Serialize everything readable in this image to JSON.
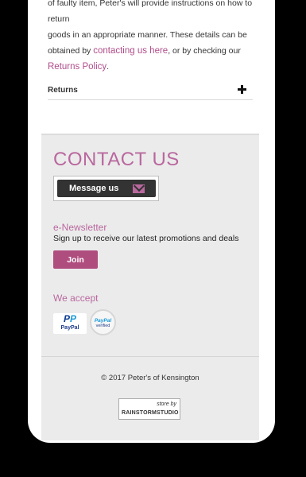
{
  "policy": {
    "line1": "of faulty item, Peter's will provide instructions on how to return",
    "line2": "goods in an appropriate manner. These details can be",
    "line3_pre": "obtained by",
    "contact_link": "contacting us here",
    "line3_post": ", or by checking our",
    "returns_policy_link": "Returns Policy",
    "period": "."
  },
  "accordion": {
    "returns_label": "Returns",
    "toggle_icon": "plus-icon"
  },
  "contact": {
    "title": "CONTACT US",
    "message_button": "Message us",
    "message_icon": "envelope-icon"
  },
  "newsletter": {
    "title": "e-Newsletter",
    "description": "Sign up to receive our latest promotions and deals",
    "join_button": "Join"
  },
  "payments": {
    "title": "We accept",
    "paypal_logo": "PayPal",
    "paypal_verified_top": "PayPal",
    "paypal_verified_bottom": "verified"
  },
  "footer": {
    "copyright": "© 2017 Peter's of Kensington",
    "store_by": "store by",
    "studio_name": "RAINSTORMSTUDIO"
  },
  "colors": {
    "accent": "#b9689e",
    "button": "#b04d7f",
    "footer_bg": "#ebebeb"
  }
}
